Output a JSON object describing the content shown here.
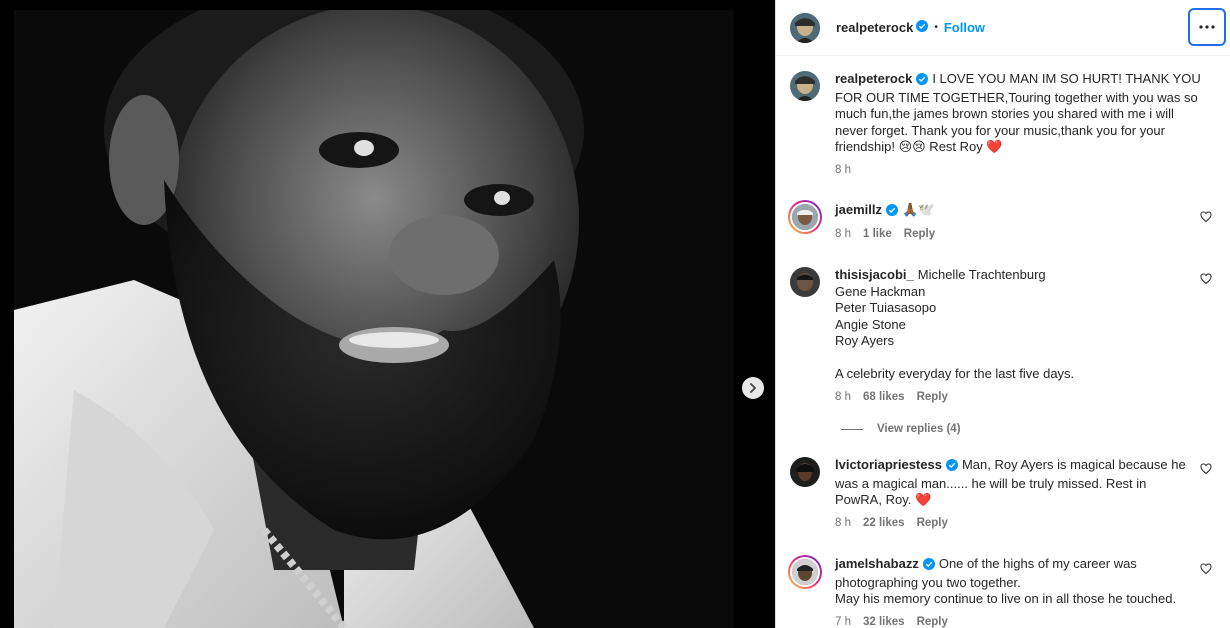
{
  "post": {
    "username": "realpeterock",
    "follow_label": "Follow",
    "more_label": "···",
    "caption": "I LOVE YOU MAN IM SO HURT! THANK YOU FOR OUR TIME TOGETHER,Touring together with you was so much fun,the james brown stories you shared with me i will never forget. Thank you for your music,thank you for your friendship! 😢😢 Rest Roy ❤️",
    "caption_time": "8 h"
  },
  "comments": [
    {
      "username": "jaemillz",
      "verified": true,
      "text": "🙏🏾🕊️",
      "time": "8 h",
      "likes": "1 like",
      "reply": "Reply"
    },
    {
      "username": "thisisjacobi_",
      "verified": false,
      "text": "Michelle Trachtenburg\nGene Hackman\nPeter Tuiasasopo\nAngie Stone\nRoy Ayers\n\nA celebrity everyday for the last five days.",
      "time": "8 h",
      "likes": "68 likes",
      "reply": "Reply",
      "view_replies": "View replies (4)"
    },
    {
      "username": "lvictoriapriestess",
      "verified": true,
      "text": "Man, Roy Ayers is magical because he was a magical man...... he will be truly missed. Rest in PowRA, Roy. ❤️",
      "time": "8 h",
      "likes": "22 likes",
      "reply": "Reply"
    },
    {
      "username": "jamelshabazz",
      "verified": true,
      "text": "One of the highs of my career was photographing you two together.\nMay his memory continue to live on in all those he touched.",
      "time": "7 h",
      "likes": "32 likes",
      "reply": "Reply"
    }
  ],
  "icons": {
    "next": "chevron-right-icon",
    "more": "more-horizontal-icon",
    "like": "heart-icon",
    "verified": "verified-badge-icon"
  },
  "colors": {
    "link_blue": "#0095f6",
    "verified_blue": "#0095f6",
    "muted": "#737373",
    "focus_ring": "#1f6feb"
  }
}
